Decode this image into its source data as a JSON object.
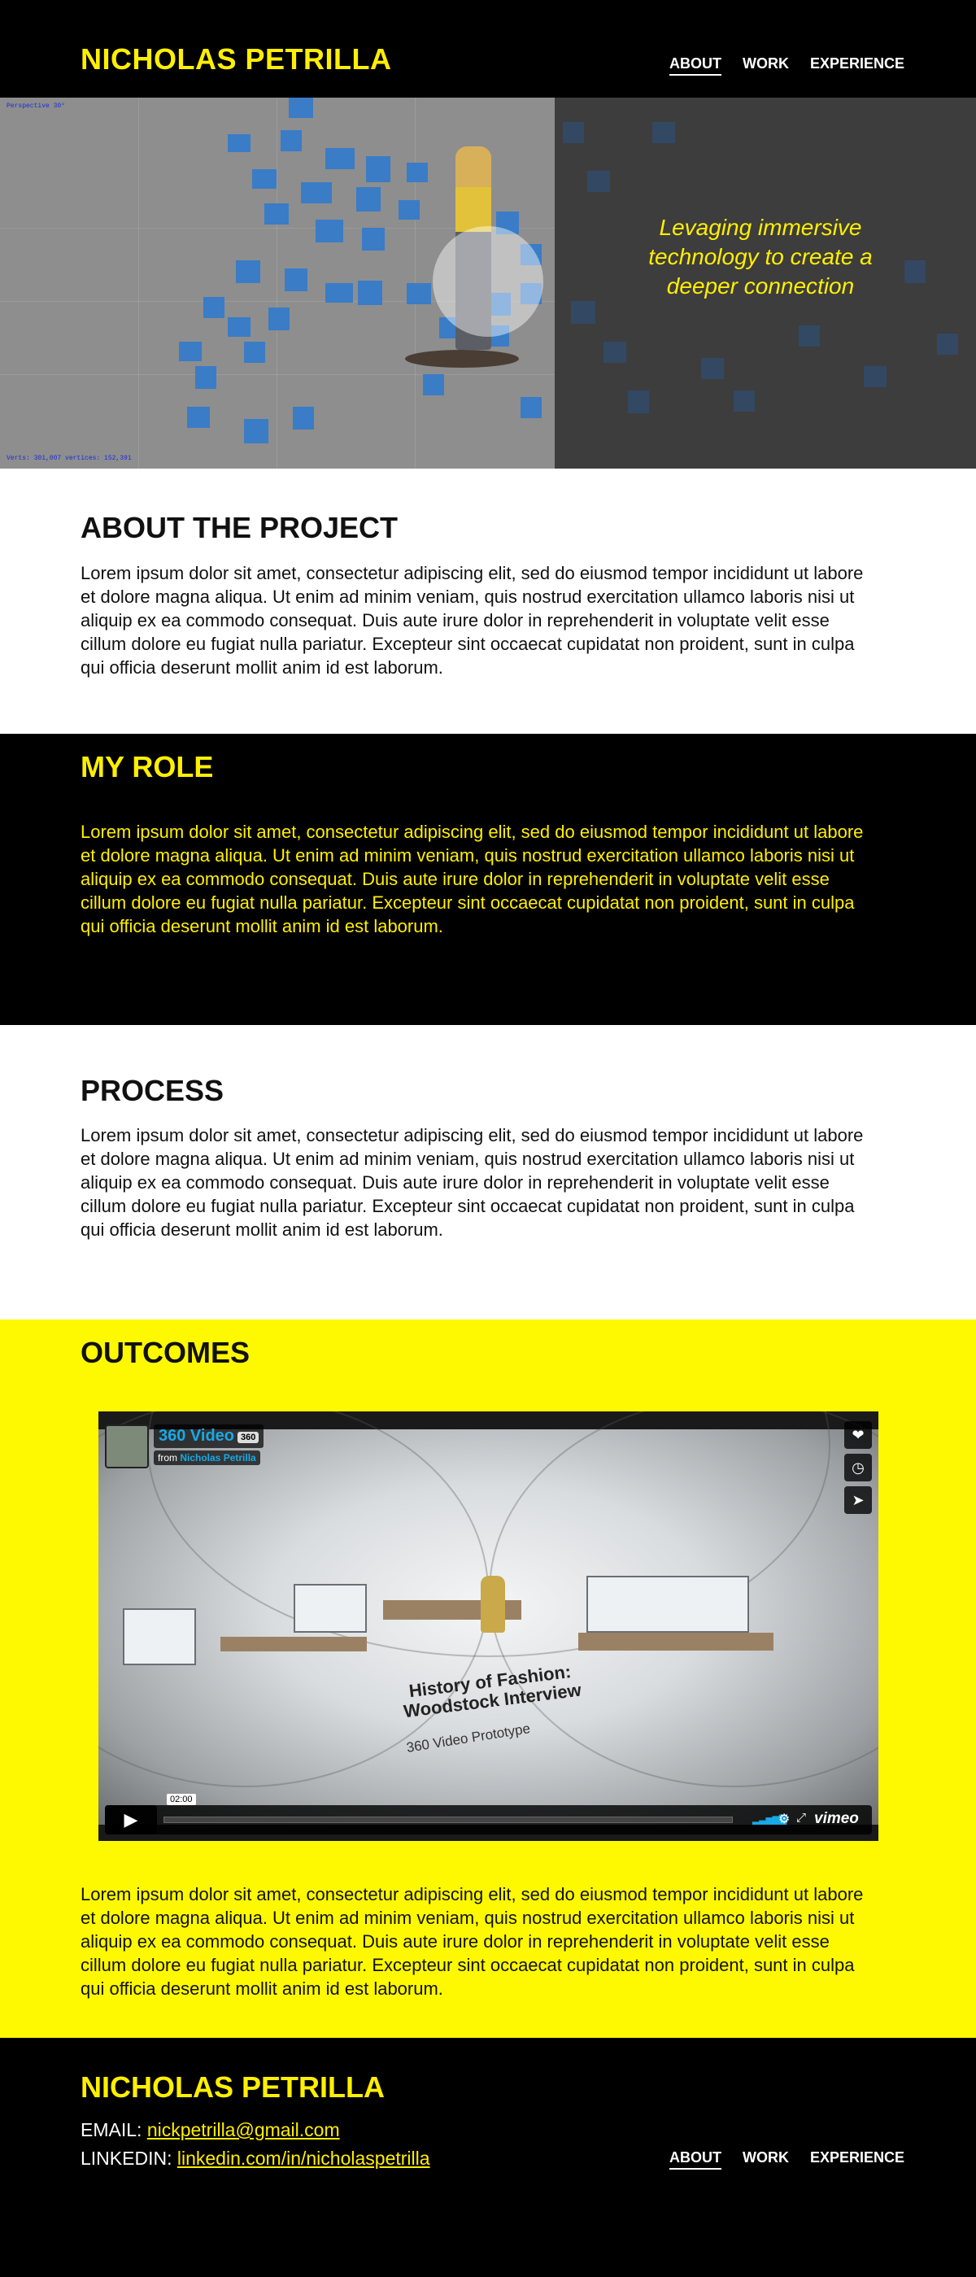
{
  "header": {
    "brand": "NICHOLAS PETRILLA",
    "nav": [
      {
        "label": "ABOUT",
        "active": true
      },
      {
        "label": "WORK",
        "active": false
      },
      {
        "label": "EXPERIENCE",
        "active": false
      }
    ]
  },
  "hero": {
    "tagline": "Levaging immersive technology to create a deeper connection",
    "viewport_label": "Perspective 30°",
    "stats_label": "Verts: 301,007 vertices: 152,391"
  },
  "about": {
    "heading": "ABOUT THE PROJECT",
    "body": "Lorem ipsum dolor sit amet, consectetur adipiscing elit, sed do eiusmod tempor incididunt ut labore et dolore magna aliqua. Ut enim ad minim veniam, quis nostrud exercitation ullamco laboris nisi ut aliquip ex ea commodo consequat. Duis aute irure dolor in reprehenderit in voluptate velit esse cillum dolore eu fugiat nulla pariatur. Excepteur sint occaecat cupidatat non proident, sunt in culpa qui officia deserunt mollit anim id est laborum."
  },
  "role": {
    "heading": "MY ROLE",
    "body": "Lorem ipsum dolor sit amet, consectetur adipiscing elit, sed do eiusmod tempor incididunt ut labore et dolore magna aliqua. Ut enim ad minim veniam, quis nostrud exercitation ullamco laboris nisi ut aliquip ex ea commodo consequat. Duis aute irure dolor in reprehenderit in voluptate velit esse cillum dolore eu fugiat nulla pariatur. Excepteur sint occaecat cupidatat non proident, sunt in culpa qui officia deserunt mollit anim id est laborum."
  },
  "process": {
    "heading": "PROCESS",
    "body": "Lorem ipsum dolor sit amet, consectetur adipiscing elit, sed do eiusmod tempor incididunt ut labore et dolore magna aliqua. Ut enim ad minim veniam, quis nostrud exercitation ullamco laboris nisi ut aliquip ex ea commodo consequat. Duis aute irure dolor in reprehenderit in voluptate velit esse cillum dolore eu fugiat nulla pariatur. Excepteur sint occaecat cupidatat non proident, sunt in culpa qui officia deserunt mollit anim id est laborum."
  },
  "outcomes": {
    "heading": "OUTCOMES",
    "video": {
      "title": "360 Video",
      "badge": "360",
      "from_label": "from",
      "author": "Nicholas Petrilla",
      "overlay_title": "History of Fashion: Woodstock Interview",
      "overlay_subtitle": "360 Video Prototype",
      "timecode": "02:00",
      "brand": "vimeo"
    },
    "body": "Lorem ipsum dolor sit amet, consectetur adipiscing elit, sed do eiusmod tempor incididunt ut labore et dolore magna aliqua. Ut enim ad minim veniam, quis nostrud exercitation ullamco laboris nisi ut aliquip ex ea commodo consequat. Duis aute irure dolor in reprehenderit in voluptate velit esse cillum dolore eu fugiat nulla pariatur. Excepteur sint occaecat cupidatat non proident, sunt in culpa qui officia deserunt mollit anim id est laborum."
  },
  "footer": {
    "brand": "NICHOLAS PETRILLA",
    "email_label": "EMAIL:",
    "email": "nickpetrilla@gmail.com",
    "linkedin_label": "LINKEDIN:",
    "linkedin": "linkedin.com/in/nicholaspetrilla",
    "nav": [
      {
        "label": "ABOUT",
        "active": true
      },
      {
        "label": "WORK",
        "active": false
      },
      {
        "label": "EXPERIENCE",
        "active": false
      }
    ]
  },
  "colors": {
    "accent": "#ffef00",
    "outcomes_bg": "#fff900",
    "dark": "#000000",
    "vimeo_blue": "#18a9e6"
  }
}
